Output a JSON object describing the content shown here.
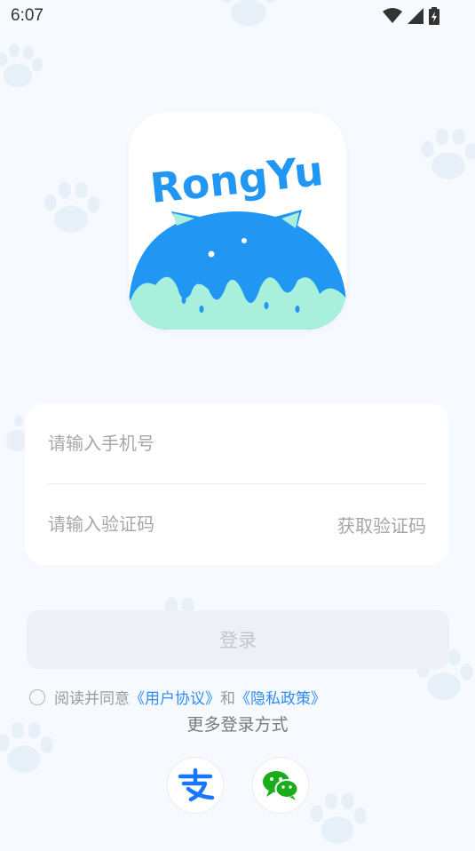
{
  "status_bar": {
    "time": "6:07"
  },
  "logo": {
    "brand_text": "RongYu"
  },
  "form": {
    "phone_placeholder": "请输入手机号",
    "code_placeholder": "请输入验证码",
    "get_code_label": "获取验证码"
  },
  "login_button_label": "登录",
  "agreement": {
    "prefix": "阅读并同意",
    "user_agreement": "《用户协议》",
    "and": "和",
    "privacy_policy": "《隐私政策》"
  },
  "more_login_label": "更多登录方式",
  "social": {
    "alipay_icon": "alipay-icon",
    "wechat_icon": "wechat-icon"
  },
  "colors": {
    "background": "#f6f9fd",
    "accent_blue": "#2196f3",
    "mint": "#a8f0dc",
    "link": "#2f8cf5",
    "paw": "#dbe8f5"
  }
}
